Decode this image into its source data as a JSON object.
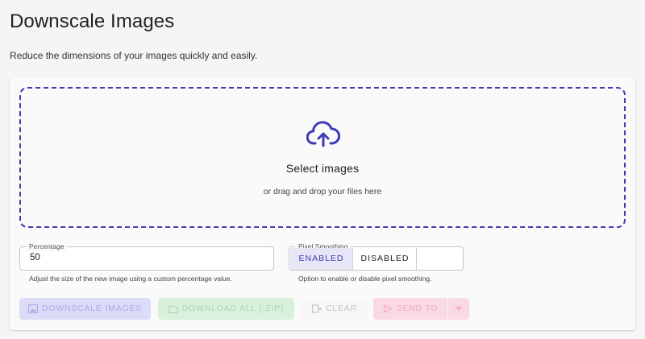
{
  "header": {
    "title": "Downscale Images",
    "subtitle": "Reduce the dimensions of your images quickly and easily."
  },
  "dropzone": {
    "icon": "cloud-upload-icon",
    "title": "Select images",
    "subtitle": "or drag and drop your files here"
  },
  "percentage": {
    "label": "Percentage",
    "value": "50",
    "help": "Adjust the size of the new image using a custom percentage value."
  },
  "smoothing": {
    "label": "Pixel Smoothing",
    "options": [
      "ENABLED",
      "DISABLED"
    ],
    "selected": "ENABLED",
    "help": "Option to enable or disable pixel smoothing."
  },
  "actions": {
    "downscale": "DOWNSCALE IMAGES",
    "download": "DOWNLOAD ALL (.ZIP)",
    "clear": "CLEAR",
    "send": "SEND TO"
  },
  "colors": {
    "accent": "#3f3cb3",
    "background": "#f5f5f5",
    "card": "#fafafa"
  }
}
